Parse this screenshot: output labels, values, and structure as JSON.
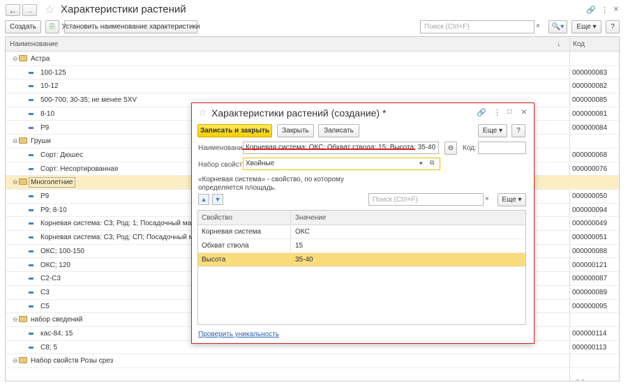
{
  "window": {
    "title": "Характеристики растений"
  },
  "toolbar": {
    "create": "Создать",
    "set_name": "Установить наименование характеристики",
    "search_placeholder": "Поиск (Ctrl+F)",
    "more": "Еще",
    "help": "?"
  },
  "list": {
    "col_name": "Наименование",
    "col_code": "Код",
    "rows": [
      {
        "type": "group",
        "name": "Астра",
        "code": ""
      },
      {
        "type": "item",
        "name": "100-125",
        "code": "000000083"
      },
      {
        "type": "item",
        "name": "10-12",
        "code": "000000082"
      },
      {
        "type": "item",
        "name": "500-700; 30-35; не менее 5XV",
        "code": "000000085"
      },
      {
        "type": "item",
        "name": "8-10",
        "code": "000000081"
      },
      {
        "type": "item",
        "name": "Р9",
        "code": "000000084"
      },
      {
        "type": "group",
        "name": "Груши",
        "code": ""
      },
      {
        "type": "item",
        "name": "Сорт: Дюшес",
        "code": "000000068"
      },
      {
        "type": "item",
        "name": "Сорт: Несортированная",
        "code": "000000076"
      },
      {
        "type": "group",
        "name": "Многолетние",
        "code": "",
        "selected": true
      },
      {
        "type": "item",
        "name": "Р9",
        "code": "000000050"
      },
      {
        "type": "item",
        "name": "Р9; 8-10",
        "code": "000000094"
      },
      {
        "type": "item",
        "name": "Корневая система: С3; Род: 1; Посадочный материал",
        "code": "000000049"
      },
      {
        "type": "item",
        "name": "Корневая система: С3; Род: СП; Посадочный материал",
        "code": "000000051"
      },
      {
        "type": "item",
        "name": "ОКС; 100-150",
        "code": "000000088"
      },
      {
        "type": "item",
        "name": "ОКС; 120",
        "code": "000000121"
      },
      {
        "type": "item",
        "name": "С2-С3",
        "code": "000000087"
      },
      {
        "type": "item",
        "name": "С3",
        "code": "000000089"
      },
      {
        "type": "item",
        "name": "С5",
        "code": "000000095"
      },
      {
        "type": "group",
        "name": "набор сведений",
        "code": ""
      },
      {
        "type": "item",
        "name": "кас-84; 15",
        "code": "000000114"
      },
      {
        "type": "item",
        "name": "С8; 5",
        "code": "000000113"
      },
      {
        "type": "group",
        "name": "Набор свойств Розы срез",
        "code": ""
      }
    ]
  },
  "dialog": {
    "title": "Характеристики растений (создание) *",
    "save_close": "Записать и закрыть",
    "close": "Закрыть",
    "save": "Записать",
    "more": "Еще",
    "help": "?",
    "name_label": "Наименование:",
    "name_value": "Корневая система: ОКС; Обхват ствола: 15; Высота: 35-40",
    "code_label": "Код:",
    "code_value": "",
    "set_label": "Набор свойств:",
    "set_value": "Хвойные",
    "note": "«Корневая система» - свойство, по которому определяется площадь.",
    "search_placeholder": "Поиск (Ctrl+F)",
    "col_prop": "Свойство",
    "col_value": "Значение",
    "props": [
      {
        "prop": "Корневая система",
        "value": "ОКС"
      },
      {
        "prop": "Обхват ствола",
        "value": "15"
      },
      {
        "prop": "Высота",
        "value": "35-40",
        "selected": true
      }
    ],
    "check_link": "Проверить уникальность"
  },
  "icons": [
    "back-arrow-icon",
    "forward-arrow-icon",
    "star-icon",
    "link-icon",
    "more-icon",
    "close-icon",
    "search-icon",
    "folder-icon",
    "move-up-icon",
    "move-down-icon",
    "dropdown-icon",
    "open-icon",
    "maximize-icon"
  ]
}
